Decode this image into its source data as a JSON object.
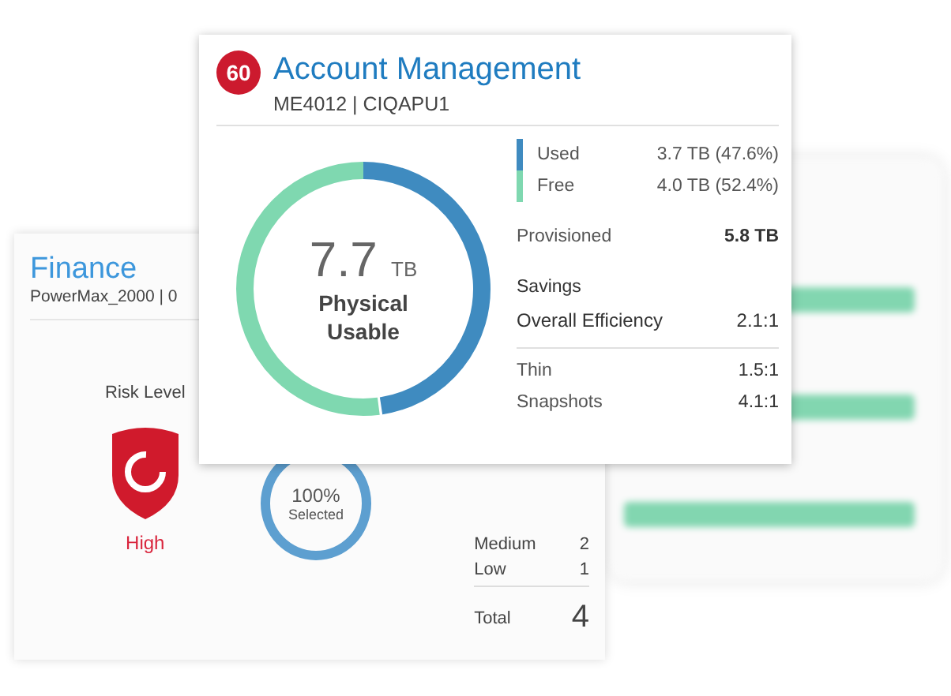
{
  "background_card": {
    "title": "Finance",
    "subtitle": "PowerMax_2000 | 0",
    "risk": {
      "label": "Risk Level",
      "value": "High"
    },
    "compliance": {
      "value": "100%",
      "caption": "Selected"
    },
    "counts": [
      {
        "label": "Medium",
        "value": "2"
      },
      {
        "label": "Low",
        "value": "1"
      }
    ],
    "total": {
      "label": "Total",
      "value": "4"
    }
  },
  "popup": {
    "badge": "60",
    "title": "Account Management",
    "subtitle": "ME4012 | CIQAPU1",
    "donut": {
      "value": "7.7",
      "unit": "TB",
      "caption": "Physical Usable",
      "level": 0.476
    },
    "legend": [
      {
        "label": "Used",
        "value": "3.7 TB (47.6%)",
        "color": "#3f8bc0"
      },
      {
        "label": "Free",
        "value": "4.0 TB (52.4%)",
        "color": "#7fd8b0"
      }
    ],
    "provisioned": {
      "label": "Provisioned",
      "value": "5.8 TB"
    },
    "savings": {
      "heading": "Savings",
      "overall": {
        "label": "Overall Efficiency",
        "value": "2.1:1"
      },
      "details": [
        {
          "label": "Thin",
          "value": "1.5:1"
        },
        {
          "label": "Snapshots",
          "value": "4.1:1"
        }
      ]
    }
  }
}
